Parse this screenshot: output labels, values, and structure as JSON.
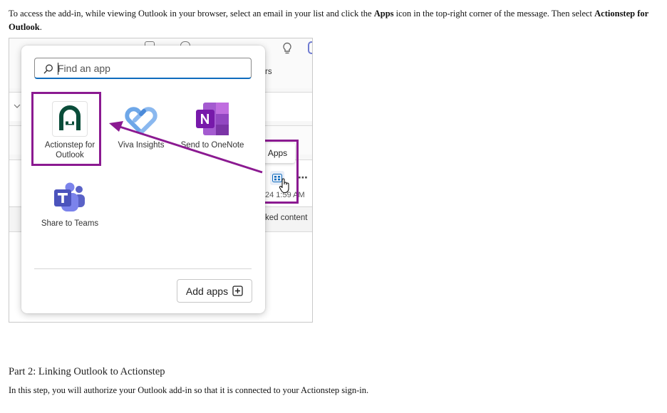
{
  "intro": {
    "part1": "To access the add-in, while viewing Outlook in your browser, select an email in your list and click the ",
    "bold1": "Apps",
    "part2": " icon in the top-right corner of the message. Then select ",
    "bold2": "Actionstep for Outlook",
    "part3": "."
  },
  "screenshot": {
    "background": {
      "fragment_rs": "rs",
      "fragment_time": "24 1:59 AM",
      "fragment_content": "ked content",
      "more_glyph": "⋯"
    },
    "search": {
      "placeholder": "Find an app"
    },
    "apps": [
      {
        "label": "Actionstep for Outlook",
        "icon": "actionstep-icon"
      },
      {
        "label": "Viva Insights",
        "icon": "viva-insights-icon"
      },
      {
        "label": "Send to OneNote",
        "icon": "onenote-icon"
      },
      {
        "label": "Share to Teams",
        "icon": "teams-icon"
      }
    ],
    "add_apps_label": "Add apps",
    "apps_tooltip": "Apps",
    "highlight_color": "#8b1a91"
  },
  "part2": {
    "title": "Part 2: Linking Outlook to Actionstep",
    "body": "In this step, you will authorize your Outlook add-in so that it is connected to your Actionstep sign-in."
  }
}
